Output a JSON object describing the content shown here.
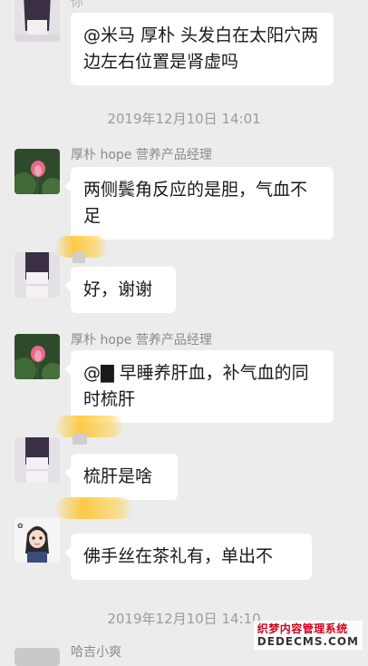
{
  "messages": {
    "m1": {
      "sender": "你",
      "text": "@米马 厚朴 头发白在太阳穴两边左右位置是肾虚吗"
    },
    "ts1": "2019年12月10日 14:01",
    "m2": {
      "sender": "厚朴 hope 营养产品经理",
      "text": "两侧鬓角反应的是胆，气血不足"
    },
    "m3": {
      "text": "好，谢谢"
    },
    "m4": {
      "sender": "厚朴 hope 营养产品经理",
      "text": "@▇ 早睡养肝血，补气血的同时梳肝"
    },
    "m5": {
      "text": "梳肝是啥"
    },
    "m6": {
      "text": "佛手丝在茶礼有，单出不"
    },
    "ts2": "2019年12月10日 14:10",
    "m7": {
      "sender": "哈吉小爽"
    }
  },
  "watermark": {
    "line1": "织梦内容管理系统",
    "line2": "DEDECMS.COM"
  },
  "colors": {
    "background": "#ececec",
    "bubble": "#ffffff",
    "timestamp": "#9b9b9b",
    "sender": "#8a8a8a",
    "highlight": "#ffc328"
  },
  "icons": [
    "avatar-girl-icon",
    "avatar-lotus-icon",
    "avatar-cartoon-girl-icon"
  ]
}
